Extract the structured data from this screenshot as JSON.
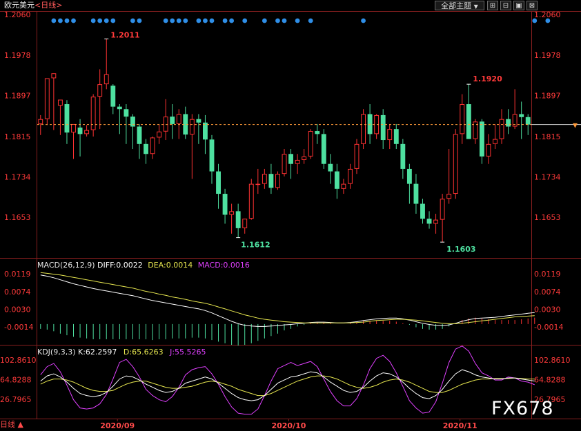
{
  "header": {
    "instrument": "欧元美元",
    "period": "<日线>",
    "theme_button": "全部主题",
    "theme_arrow": "▼",
    "win_btn_1": "⊞",
    "win_btn_2": "⊟",
    "win_btn_3": "▣",
    "win_btn_4": "⊠"
  },
  "price_panel": {
    "axis_labels": [
      "1.2060",
      "1.1978",
      "1.1897",
      "1.1815",
      "1.1734",
      "1.1653"
    ],
    "high_label": "1.2011",
    "high_label_2": "1.1920",
    "low_label": "1.1612",
    "low_label_2": "1.1603",
    "current_marker": "▼"
  },
  "macd_panel": {
    "title_name": "MACD(26,12,9)",
    "diff_label": "DIFF:0.0022",
    "dea_label": "DEA:0.0014",
    "macd_label": "MACD:0.0016",
    "axis_labels": [
      "0.0119",
      "0.0074",
      "0.0030",
      "-0.0014"
    ]
  },
  "kdj_panel": {
    "title_name": "KDJ(9,3,3)",
    "k_label": "K:62.2597",
    "d_label": "D:65.6263",
    "j_label": "J:55.5265",
    "axis_labels": [
      "102.8610",
      "64.8288",
      "26.7965"
    ]
  },
  "x_axis": {
    "labels": [
      "2020/09",
      "2020/10",
      "2020/11"
    ],
    "left_label": "日线 ▲"
  },
  "watermark": "FX678",
  "colors": {
    "up": "#ff3232",
    "down": "#4ee0a0",
    "dots": "#2f8fe8",
    "diff": "#ffffff",
    "dea": "#e8e850",
    "kdj_j": "#e040ff",
    "axis_text": "#ff3a3a",
    "green_label": "#4ee0a0",
    "red_label": "#ff3a3a",
    "grid": "#8a1f1f"
  },
  "chart_data": [
    {
      "type": "candlestick",
      "title": "欧元美元<日线>",
      "ylim": [
        1.1603,
        1.206
      ],
      "y_ticks": [
        1.206,
        1.1978,
        1.1897,
        1.1815,
        1.1734,
        1.1653
      ],
      "x_ticks": [
        "2020/09",
        "2020/10",
        "2020/11"
      ],
      "current_price": 1.1839,
      "annotations": [
        {
          "text": "1.2011",
          "value": 1.2011
        },
        {
          "text": "1.1920",
          "value": 1.192
        },
        {
          "text": "1.1612",
          "value": 1.1612
        },
        {
          "text": "1.1603",
          "value": 1.1603
        }
      ],
      "signal_dot_indices": [
        2,
        3,
        4,
        5,
        8,
        9,
        10,
        11,
        14,
        15,
        19,
        20,
        21,
        22,
        24,
        25,
        26,
        28,
        29,
        31,
        34,
        36,
        37,
        39,
        41,
        49,
        75,
        77
      ],
      "candles": [
        [
          1.184,
          1.1858,
          1.1818,
          1.185
        ],
        [
          1.185,
          1.19,
          1.1838,
          1.1932
        ],
        [
          1.1932,
          1.1942,
          1.1828,
          1.1942
        ],
        [
          1.1877,
          1.188,
          1.1818,
          1.1889
        ],
        [
          1.188,
          1.1888,
          1.18,
          1.1823
        ],
        [
          1.1823,
          1.1835,
          1.177,
          1.184
        ],
        [
          1.1833,
          1.185,
          1.1775,
          1.182
        ],
        [
          1.182,
          1.1838,
          1.1815,
          1.1828
        ],
        [
          1.1828,
          1.19,
          1.1815,
          1.1895
        ],
        [
          1.1895,
          1.195,
          1.183,
          1.192
        ],
        [
          1.192,
          1.2011,
          1.191,
          1.194
        ],
        [
          1.1917,
          1.192,
          1.186,
          1.1875
        ],
        [
          1.1875,
          1.188,
          1.182,
          1.187
        ],
        [
          1.187,
          1.188,
          1.18,
          1.1855
        ],
        [
          1.1855,
          1.186,
          1.179,
          1.1835
        ],
        [
          1.1835,
          1.184,
          1.177,
          1.18
        ],
        [
          1.18,
          1.181,
          1.176,
          1.178
        ],
        [
          1.178,
          1.1815,
          1.177,
          1.1813
        ],
        [
          1.1813,
          1.184,
          1.18,
          1.1825
        ],
        [
          1.1825,
          1.189,
          1.1808,
          1.1855
        ],
        [
          1.1855,
          1.188,
          1.181,
          1.184
        ],
        [
          1.184,
          1.187,
          1.181,
          1.186
        ],
        [
          1.186,
          1.1875,
          1.181,
          1.1819
        ],
        [
          1.1819,
          1.186,
          1.173,
          1.185
        ],
        [
          1.185,
          1.186,
          1.18,
          1.1843
        ],
        [
          1.1843,
          1.1858,
          1.178,
          1.1809
        ],
        [
          1.1809,
          1.1818,
          1.172,
          1.1745
        ],
        [
          1.1745,
          1.176,
          1.167,
          1.17
        ],
        [
          1.17,
          1.171,
          1.164,
          1.1658
        ],
        [
          1.1658,
          1.168,
          1.162,
          1.1665
        ],
        [
          1.1665,
          1.168,
          1.1612,
          1.1631
        ],
        [
          1.1631,
          1.165,
          1.162,
          1.165
        ],
        [
          1.165,
          1.173,
          1.1648,
          1.172
        ],
        [
          1.172,
          1.175,
          1.17,
          1.172
        ],
        [
          1.172,
          1.175,
          1.171,
          1.174
        ],
        [
          1.174,
          1.176,
          1.17,
          1.1712
        ],
        [
          1.1712,
          1.1745,
          1.1708,
          1.174
        ],
        [
          1.174,
          1.179,
          1.1735,
          1.178
        ],
        [
          1.178,
          1.179,
          1.173,
          1.176
        ],
        [
          1.176,
          1.178,
          1.174,
          1.1768
        ],
        [
          1.1768,
          1.179,
          1.176,
          1.1775
        ],
        [
          1.1775,
          1.183,
          1.177,
          1.1826
        ],
        [
          1.1826,
          1.184,
          1.18,
          1.182
        ],
        [
          1.182,
          1.183,
          1.175,
          1.176
        ],
        [
          1.176,
          1.178,
          1.172,
          1.1745
        ],
        [
          1.1745,
          1.176,
          1.169,
          1.171
        ],
        [
          1.171,
          1.173,
          1.17,
          1.172
        ],
        [
          1.172,
          1.176,
          1.171,
          1.175
        ],
        [
          1.175,
          1.181,
          1.174,
          1.18
        ],
        [
          1.18,
          1.187,
          1.179,
          1.186
        ],
        [
          1.186,
          1.188,
          1.18,
          1.182
        ],
        [
          1.182,
          1.186,
          1.181,
          1.1858
        ],
        [
          1.1858,
          1.187,
          1.179,
          1.1808
        ],
        [
          1.1808,
          1.184,
          1.179,
          1.183
        ],
        [
          1.183,
          1.184,
          1.179,
          1.18
        ],
        [
          1.18,
          1.181,
          1.173,
          1.175
        ],
        [
          1.175,
          1.176,
          1.168,
          1.172
        ],
        [
          1.172,
          1.174,
          1.166,
          1.168
        ],
        [
          1.168,
          1.169,
          1.164,
          1.165
        ],
        [
          1.165,
          1.1665,
          1.163,
          1.164
        ],
        [
          1.164,
          1.166,
          1.162,
          1.1648
        ],
        [
          1.1648,
          1.17,
          1.1603,
          1.169
        ],
        [
          1.169,
          1.179,
          1.168,
          1.17
        ],
        [
          1.17,
          1.183,
          1.169,
          1.182
        ],
        [
          1.182,
          1.19,
          1.18,
          1.188
        ],
        [
          1.188,
          1.192,
          1.186,
          1.181
        ],
        [
          1.181,
          1.185,
          1.18,
          1.1845
        ],
        [
          1.1845,
          1.185,
          1.176,
          1.1775
        ],
        [
          1.1775,
          1.182,
          1.176,
          1.18
        ],
        [
          1.18,
          1.184,
          1.179,
          1.181
        ],
        [
          1.181,
          1.187,
          1.18,
          1.185
        ],
        [
          1.185,
          1.187,
          1.182,
          1.1835
        ],
        [
          1.1835,
          1.191,
          1.183,
          1.186
        ],
        [
          1.186,
          1.1885,
          1.181,
          1.1854
        ],
        [
          1.1854,
          1.186,
          1.1818,
          1.1839
        ]
      ]
    },
    {
      "type": "line",
      "title": "MACD(26,12,9)",
      "ylim": [
        -0.005,
        0.0125
      ],
      "y_ticks": [
        0.0119,
        0.0074,
        0.003,
        -0.0014
      ],
      "series": [
        {
          "name": "DIFF",
          "values": [
            0.0116,
            0.0113,
            0.0109,
            0.0104,
            0.0099,
            0.0094,
            0.009,
            0.0086,
            0.0082,
            0.0079,
            0.0076,
            0.0073,
            0.007,
            0.0067,
            0.0064,
            0.006,
            0.0056,
            0.0052,
            0.0049,
            0.0046,
            0.0043,
            0.004,
            0.0037,
            0.0034,
            0.0031,
            0.0027,
            0.0021,
            0.0014,
            0.0007,
            0.0,
            -0.0006,
            -0.001,
            -0.0012,
            -0.0013,
            -0.0013,
            -0.0012,
            -0.0011,
            -0.0009,
            -0.0008,
            -0.0006,
            -0.0005,
            -0.0003,
            -0.0002,
            -0.0002,
            -0.0003,
            -0.0004,
            -0.0004,
            -0.0003,
            -0.0001,
            0.0002,
            0.0004,
            0.0006,
            0.0007,
            0.0008,
            0.0008,
            0.0006,
            0.0003,
            -0.0001,
            -0.0005,
            -0.0008,
            -0.001,
            -0.0011,
            -0.0009,
            -0.0005,
            0.0,
            0.0004,
            0.0007,
            0.0008,
            0.0009,
            0.001,
            0.0012,
            0.0014,
            0.0016,
            0.0018,
            0.002,
            0.0022
          ]
        },
        {
          "name": "DEA",
          "values": [
            0.0122,
            0.012,
            0.0118,
            0.0116,
            0.0113,
            0.011,
            0.0107,
            0.0104,
            0.0101,
            0.0098,
            0.0095,
            0.0092,
            0.0089,
            0.0086,
            0.0083,
            0.0079,
            0.0075,
            0.0072,
            0.0068,
            0.0065,
            0.0061,
            0.0058,
            0.0055,
            0.0051,
            0.0048,
            0.0045,
            0.0041,
            0.0036,
            0.0031,
            0.0026,
            0.0021,
            0.0016,
            0.0012,
            0.0008,
            0.0005,
            0.0003,
            0.0001,
            -0.0001,
            -0.0002,
            -0.0003,
            -0.0004,
            -0.0004,
            -0.0004,
            -0.0004,
            -0.0004,
            -0.0004,
            -0.0004,
            -0.0004,
            -0.0003,
            -0.0002,
            0.0,
            0.0002,
            0.0003,
            0.0004,
            0.0005,
            0.0005,
            0.0004,
            0.0003,
            0.0001,
            -0.0001,
            -0.0003,
            -0.0005,
            -0.0006,
            -0.0006,
            -0.0005,
            -0.0003,
            -0.0001,
            0.0001,
            0.0003,
            0.0005,
            0.0007,
            0.0009,
            0.0011,
            0.0012,
            0.0013,
            0.0014
          ]
        },
        {
          "name": "MACD",
          "values": [
            -0.0012,
            -0.0014,
            -0.0018,
            -0.0024,
            -0.0028,
            -0.0032,
            -0.0034,
            -0.0036,
            -0.0038,
            -0.0038,
            -0.0038,
            -0.0038,
            -0.0038,
            -0.0038,
            -0.0038,
            -0.0038,
            -0.0038,
            -0.004,
            -0.0038,
            -0.0038,
            -0.0036,
            -0.0036,
            -0.0036,
            -0.0034,
            -0.0034,
            -0.0036,
            -0.004,
            -0.0044,
            -0.0048,
            -0.0052,
            -0.0054,
            -0.0052,
            -0.0048,
            -0.0042,
            -0.0036,
            -0.003,
            -0.0024,
            -0.0016,
            -0.0012,
            -0.0006,
            -0.0002,
            0.0002,
            0.0004,
            0.0004,
            0.0002,
            0.0,
            0.0,
            0.0002,
            0.0004,
            0.0008,
            0.0008,
            0.0008,
            0.0008,
            0.0008,
            0.0006,
            0.0002,
            -0.0002,
            -0.0008,
            -0.0012,
            -0.0014,
            -0.0014,
            -0.0012,
            -0.0006,
            0.0002,
            0.001,
            0.0014,
            0.0016,
            0.0014,
            0.0012,
            0.001,
            0.001,
            0.001,
            0.001,
            0.0012,
            0.0014,
            0.0016
          ]
        }
      ]
    },
    {
      "type": "line",
      "title": "KDJ(9,3,3)",
      "ylim": [
        15,
        110
      ],
      "y_ticks": [
        102.861,
        64.8288,
        26.7965
      ],
      "series": [
        {
          "name": "K",
          "values": [
            62,
            72,
            76,
            70,
            60,
            48,
            38,
            34,
            32,
            34,
            40,
            52,
            66,
            72,
            70,
            64,
            56,
            50,
            44,
            40,
            42,
            48,
            58,
            62,
            66,
            70,
            66,
            58,
            48,
            38,
            30,
            26,
            24,
            26,
            34,
            46,
            58,
            64,
            70,
            72,
            76,
            80,
            78,
            70,
            60,
            52,
            44,
            40,
            42,
            50,
            62,
            72,
            78,
            76,
            70,
            60,
            48,
            38,
            30,
            28,
            34,
            46,
            62,
            76,
            84,
            80,
            74,
            70,
            68,
            66,
            66,
            68,
            68,
            66,
            64,
            62
          ]
        },
        {
          "name": "D",
          "values": [
            56,
            62,
            66,
            66,
            64,
            60,
            54,
            48,
            44,
            42,
            42,
            44,
            50,
            56,
            60,
            62,
            62,
            58,
            54,
            50,
            48,
            48,
            50,
            52,
            56,
            60,
            62,
            60,
            56,
            52,
            46,
            42,
            38,
            34,
            34,
            38,
            44,
            50,
            56,
            62,
            66,
            70,
            72,
            72,
            70,
            66,
            60,
            54,
            50,
            48,
            50,
            54,
            60,
            64,
            66,
            64,
            60,
            54,
            48,
            42,
            40,
            40,
            44,
            50,
            56,
            60,
            64,
            66,
            66,
            67,
            67,
            67,
            68,
            67,
            66,
            66
          ]
        },
        {
          "name": "J",
          "values": [
            74,
            90,
            96,
            80,
            54,
            26,
            10,
            8,
            10,
            18,
            36,
            66,
            98,
            104,
            90,
            70,
            46,
            34,
            26,
            22,
            32,
            50,
            74,
            84,
            88,
            90,
            76,
            56,
            32,
            12,
            0,
            -2,
            -2,
            8,
            34,
            62,
            86,
            92,
            98,
            92,
            96,
            100,
            90,
            66,
            42,
            24,
            14,
            14,
            28,
            54,
            86,
            106,
            112,
            100,
            78,
            52,
            24,
            10,
            0,
            2,
            22,
            58,
            98,
            124,
            130,
            120,
            96,
            78,
            72,
            64,
            64,
            70,
            68,
            62,
            60,
            55
          ]
        }
      ]
    }
  ]
}
